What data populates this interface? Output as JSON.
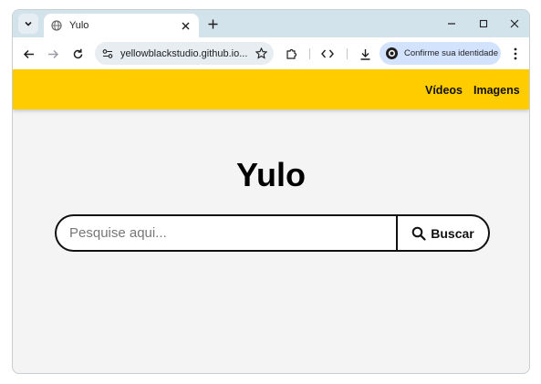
{
  "browser": {
    "tab": {
      "title": "Yulo"
    },
    "address_bar": {
      "url": "yellowblackstudio.github.io..."
    },
    "profile_chip": {
      "label": "Confirme sua identidade"
    }
  },
  "page": {
    "nav": [
      {
        "label": "Vídeos"
      },
      {
        "label": "Imagens"
      }
    ],
    "logo": "Yulo",
    "search": {
      "placeholder": "Pesquise aqui...",
      "value": "",
      "button_label": "Buscar"
    }
  },
  "colors": {
    "header_bg": "#ffcc00",
    "page_bg": "#f4f4f4",
    "tabstrip_bg": "#d3e3ec",
    "profile_chip_bg": "#d3e3fd"
  }
}
